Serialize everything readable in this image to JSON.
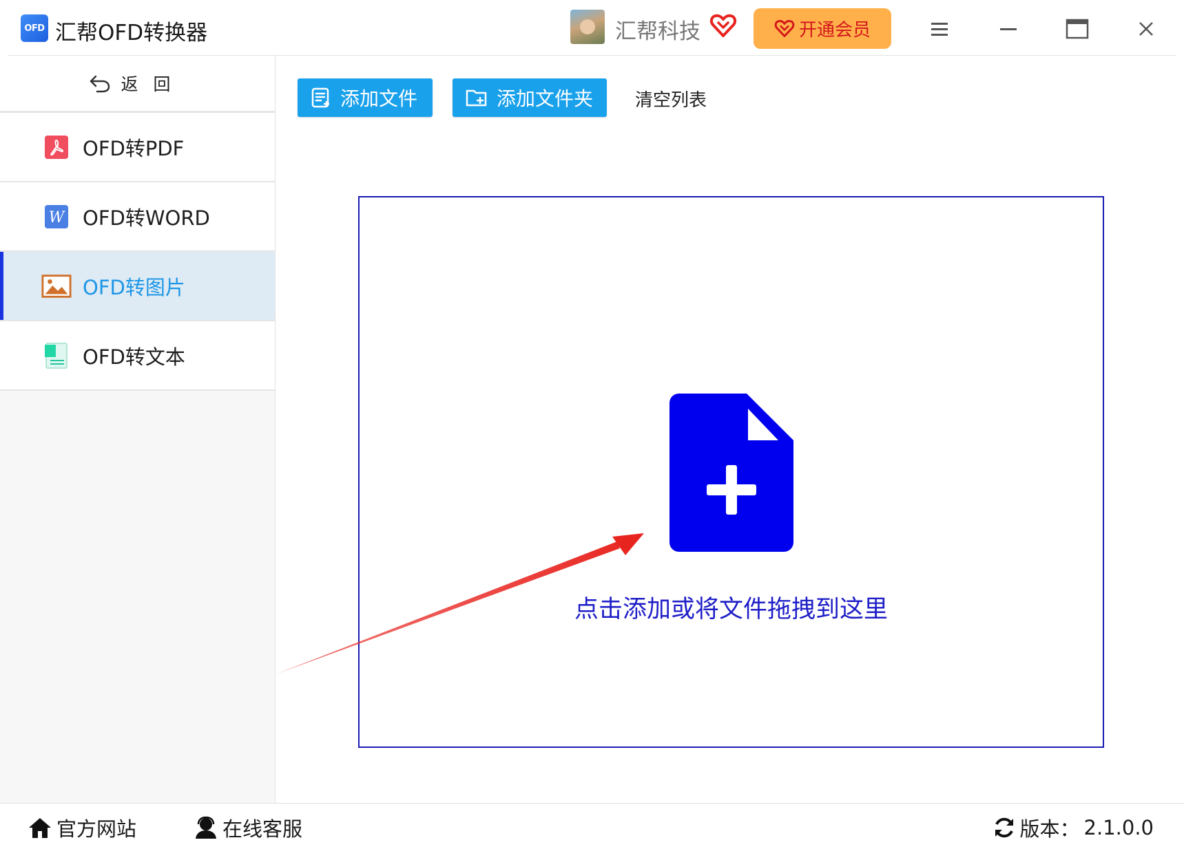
{
  "app": {
    "logo_text": "OFD",
    "title": "汇帮OFD转换器"
  },
  "user": {
    "name": "汇帮科技"
  },
  "header": {
    "vip_label": "开通会员"
  },
  "colors": {
    "accent": "#1aa1ec",
    "vip": "#ffb04a",
    "vip_text": "#d3161b",
    "dropzone_border": "#1a1ab0",
    "file_icon": "#0000ee",
    "arrow": "#e8241f"
  },
  "sidebar": {
    "back_label": "返回",
    "items": [
      {
        "label": "OFD转PDF",
        "icon": "pdf-icon",
        "active": false
      },
      {
        "label": "OFD转WORD",
        "icon": "word-icon",
        "active": false
      },
      {
        "label": "OFD转图片",
        "icon": "image-icon",
        "active": true
      },
      {
        "label": "OFD转文本",
        "icon": "text-icon",
        "active": false
      }
    ]
  },
  "toolbar": {
    "add_file": "添加文件",
    "add_folder": "添加文件夹",
    "clear_list": "清空列表"
  },
  "dropzone": {
    "label": "点击添加或将文件拖拽到这里"
  },
  "footer": {
    "website": "官方网站",
    "support": "在线客服",
    "version_label": "版本：",
    "version": "2.1.0.0"
  }
}
